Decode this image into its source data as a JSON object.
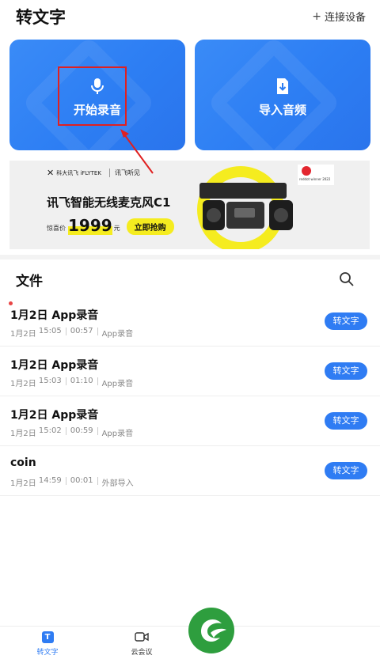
{
  "header": {
    "title": "转文字",
    "connect_plus": "+",
    "connect_label": "连接设备"
  },
  "cards": {
    "record_label": "开始录音",
    "record_icon": "microphone-icon",
    "import_label": "导入音频",
    "import_icon": "import-file-icon"
  },
  "annotation": {
    "box_color": "#e02020",
    "arrow_color": "#e02020"
  },
  "banner": {
    "brand_text": "科大讯飞 iFLYTEK",
    "brand2_text": "讯飞听见",
    "award_text": "reddot winner 2022",
    "title": "讯飞智能无线麦克风C1",
    "price_label": "惊喜价",
    "price": "1999",
    "price_unit": "元",
    "buy_label": "立即抢购"
  },
  "files": {
    "title": "文件",
    "search_icon": "search-icon",
    "items": [
      {
        "name": "1月2日 App录音",
        "date": "1月2日",
        "time": "15:05",
        "duration": "00:57",
        "source": "App录音",
        "button": "转文字",
        "unread": true
      },
      {
        "name": "1月2日 App录音",
        "date": "1月2日",
        "time": "15:03",
        "duration": "01:10",
        "source": "App录音",
        "button": "转文字",
        "unread": false
      },
      {
        "name": "1月2日 App录音",
        "date": "1月2日",
        "time": "15:02",
        "duration": "00:59",
        "source": "App录音",
        "button": "转文字",
        "unread": false
      },
      {
        "name": "coin",
        "date": "1月2日",
        "time": "14:59",
        "duration": "00:01",
        "source": "外部导入",
        "button": "转文字",
        "unread": false
      }
    ]
  },
  "tabbar": {
    "tab1_label": "转文字",
    "tab1_icon_glyph": "T",
    "tab2_label": "云会议"
  },
  "colors": {
    "primary": "#2f7cf3",
    "card_gradient_start": "#3a8bf7",
    "highlight": "#f5ec1f",
    "unread_dot": "#e84545"
  }
}
